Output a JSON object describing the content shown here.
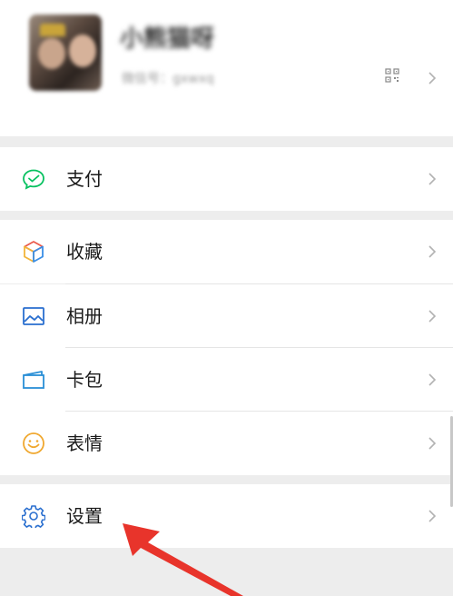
{
  "profile": {
    "nickname": "小熊猫呀",
    "wechat_id": "微信号：gxwxq"
  },
  "menu": {
    "pay": {
      "label": "支付",
      "icon": "wechat-pay-icon"
    },
    "favorites": {
      "label": "收藏",
      "icon": "cube-icon"
    },
    "album": {
      "label": "相册",
      "icon": "image-icon"
    },
    "cards": {
      "label": "卡包",
      "icon": "card-icon"
    },
    "stickers": {
      "label": "表情",
      "icon": "smiley-icon"
    },
    "settings": {
      "label": "设置",
      "icon": "gear-icon"
    }
  },
  "colors": {
    "background": "#ededed",
    "pay_green": "#07c160",
    "settings_blue": "#2a6fcf",
    "annotation_red": "#e8342b"
  },
  "annotation": {
    "type": "red-arrow",
    "target": "settings"
  }
}
